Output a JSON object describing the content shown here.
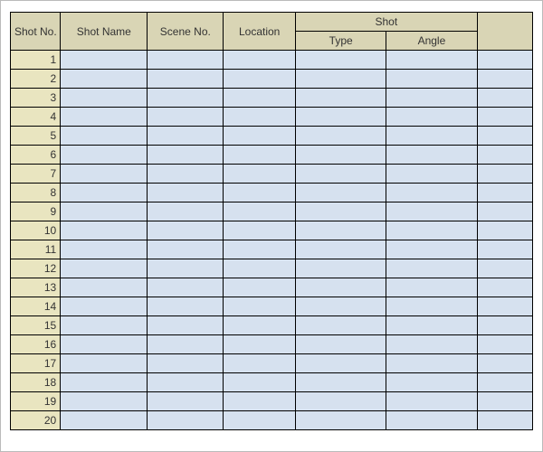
{
  "headers": {
    "shot_no": "Shot No.",
    "shot_name": "Shot Name",
    "scene_no": "Scene No.",
    "location": "Location",
    "shot_group": "Shot",
    "shot_type": "Type",
    "shot_angle": "Angle"
  },
  "rows": [
    {
      "no": "1",
      "name": "",
      "scene": "",
      "location": "",
      "type": "",
      "angle": "",
      "extra": ""
    },
    {
      "no": "2",
      "name": "",
      "scene": "",
      "location": "",
      "type": "",
      "angle": "",
      "extra": ""
    },
    {
      "no": "3",
      "name": "",
      "scene": "",
      "location": "",
      "type": "",
      "angle": "",
      "extra": ""
    },
    {
      "no": "4",
      "name": "",
      "scene": "",
      "location": "",
      "type": "",
      "angle": "",
      "extra": ""
    },
    {
      "no": "5",
      "name": "",
      "scene": "",
      "location": "",
      "type": "",
      "angle": "",
      "extra": ""
    },
    {
      "no": "6",
      "name": "",
      "scene": "",
      "location": "",
      "type": "",
      "angle": "",
      "extra": ""
    },
    {
      "no": "7",
      "name": "",
      "scene": "",
      "location": "",
      "type": "",
      "angle": "",
      "extra": ""
    },
    {
      "no": "8",
      "name": "",
      "scene": "",
      "location": "",
      "type": "",
      "angle": "",
      "extra": ""
    },
    {
      "no": "9",
      "name": "",
      "scene": "",
      "location": "",
      "type": "",
      "angle": "",
      "extra": ""
    },
    {
      "no": "10",
      "name": "",
      "scene": "",
      "location": "",
      "type": "",
      "angle": "",
      "extra": ""
    },
    {
      "no": "11",
      "name": "",
      "scene": "",
      "location": "",
      "type": "",
      "angle": "",
      "extra": ""
    },
    {
      "no": "12",
      "name": "",
      "scene": "",
      "location": "",
      "type": "",
      "angle": "",
      "extra": ""
    },
    {
      "no": "13",
      "name": "",
      "scene": "",
      "location": "",
      "type": "",
      "angle": "",
      "extra": ""
    },
    {
      "no": "14",
      "name": "",
      "scene": "",
      "location": "",
      "type": "",
      "angle": "",
      "extra": ""
    },
    {
      "no": "15",
      "name": "",
      "scene": "",
      "location": "",
      "type": "",
      "angle": "",
      "extra": ""
    },
    {
      "no": "16",
      "name": "",
      "scene": "",
      "location": "",
      "type": "",
      "angle": "",
      "extra": ""
    },
    {
      "no": "17",
      "name": "",
      "scene": "",
      "location": "",
      "type": "",
      "angle": "",
      "extra": ""
    },
    {
      "no": "18",
      "name": "",
      "scene": "",
      "location": "",
      "type": "",
      "angle": "",
      "extra": ""
    },
    {
      "no": "19",
      "name": "",
      "scene": "",
      "location": "",
      "type": "",
      "angle": "",
      "extra": ""
    },
    {
      "no": "20",
      "name": "",
      "scene": "",
      "location": "",
      "type": "",
      "angle": "",
      "extra": ""
    }
  ]
}
